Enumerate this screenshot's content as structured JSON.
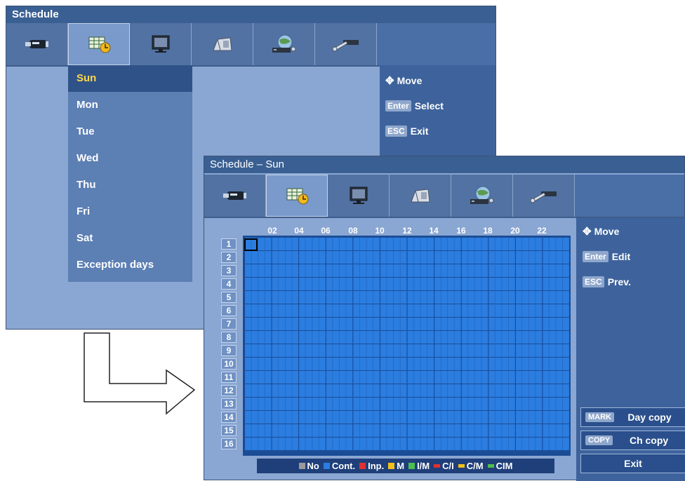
{
  "schedule_window": {
    "title": "Schedule",
    "days": [
      "Sun",
      "Mon",
      "Tue",
      "Wed",
      "Thu",
      "Fri",
      "Sat",
      "Exception days"
    ],
    "selected_day": "Sun",
    "help": {
      "move": "Move",
      "enter_key": "Enter",
      "select": "Select",
      "esc_key": "ESC",
      "exit": "Exit"
    }
  },
  "tab_icons": [
    "camera-icon",
    "schedule-icon",
    "monitor-icon",
    "record-icon",
    "network-icon",
    "tools-icon"
  ],
  "sun_window": {
    "title": "Schedule – Sun",
    "hours": [
      "02",
      "04",
      "06",
      "08",
      "10",
      "12",
      "14",
      "16",
      "18",
      "20",
      "22"
    ],
    "channels": [
      "1",
      "2",
      "3",
      "4",
      "5",
      "6",
      "7",
      "8",
      "9",
      "10",
      "11",
      "12",
      "13",
      "14",
      "15",
      "16"
    ],
    "help": {
      "move": "Move",
      "enter_key": "Enter",
      "edit": "Edit",
      "esc_key": "ESC",
      "prev": "Prev."
    },
    "legend": [
      {
        "label": "No",
        "color": "#9a9a9a"
      },
      {
        "label": "Cont.",
        "color": "#2b7de0"
      },
      {
        "label": "Inp.",
        "color": "#e03030"
      },
      {
        "label": "M",
        "color": "#f2c018"
      },
      {
        "label": "I/M",
        "color": "#4cc04c"
      },
      {
        "label": "C/I",
        "color": "#e03030"
      },
      {
        "label": "C/M",
        "color": "#f2c018"
      },
      {
        "label": "CIM",
        "color": "#4cc04c"
      }
    ],
    "buttons": {
      "mark_key": "MARK",
      "day_copy": "Day copy",
      "copy_key": "COPY",
      "ch_copy": "Ch copy",
      "exit": "Exit"
    }
  }
}
